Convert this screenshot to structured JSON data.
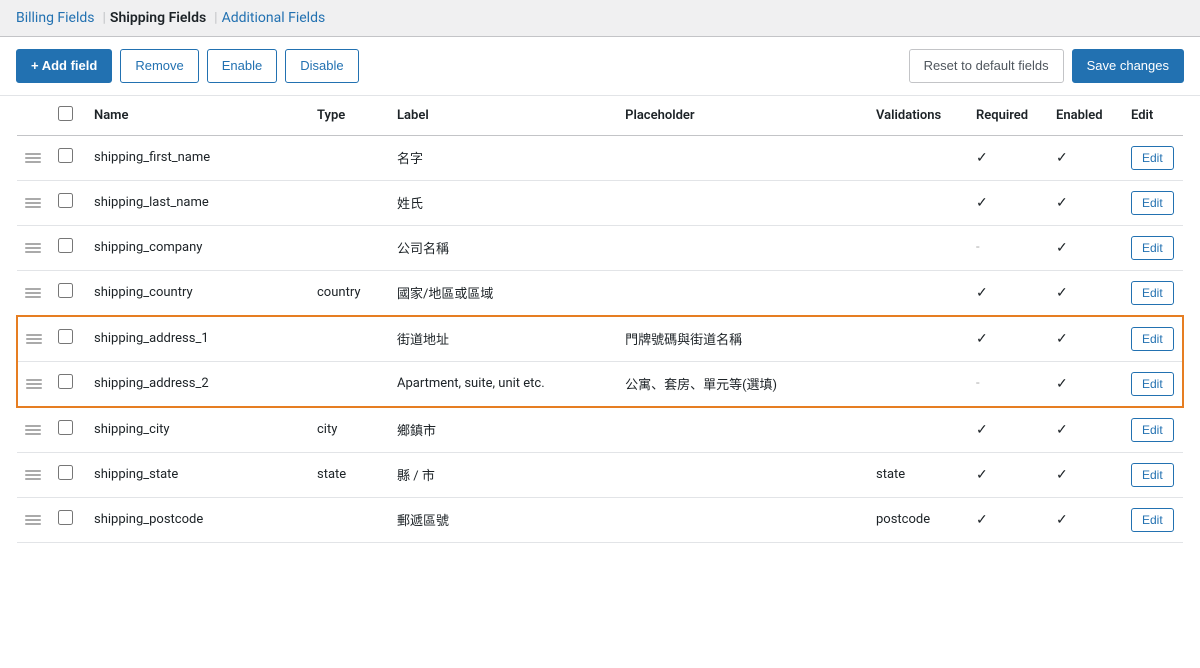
{
  "tabs": [
    {
      "id": "billing",
      "label": "Billing Fields",
      "active": false
    },
    {
      "id": "shipping",
      "label": "Shipping Fields",
      "active": true
    },
    {
      "id": "additional",
      "label": "Additional Fields",
      "active": false
    }
  ],
  "toolbar": {
    "add_field_label": "+ Add field",
    "remove_label": "Remove",
    "enable_label": "Enable",
    "disable_label": "Disable",
    "reset_label": "Reset to default fields",
    "save_label": "Save changes"
  },
  "table": {
    "headers": {
      "name": "Name",
      "type": "Type",
      "label": "Label",
      "placeholder": "Placeholder",
      "validations": "Validations",
      "required": "Required",
      "enabled": "Enabled",
      "edit": "Edit"
    },
    "rows": [
      {
        "name": "shipping_first_name",
        "type": "",
        "label": "名字",
        "placeholder": "",
        "validations": "",
        "required": true,
        "enabled": true,
        "highlighted": false
      },
      {
        "name": "shipping_last_name",
        "type": "",
        "label": "姓氏",
        "placeholder": "",
        "validations": "",
        "required": true,
        "enabled": true,
        "highlighted": false
      },
      {
        "name": "shipping_company",
        "type": "",
        "label": "公司名稱",
        "placeholder": "",
        "validations": "",
        "required": false,
        "enabled": true,
        "highlighted": false
      },
      {
        "name": "shipping_country",
        "type": "country",
        "label": "國家/地區或區域",
        "placeholder": "",
        "validations": "",
        "required": true,
        "enabled": true,
        "highlighted": false
      },
      {
        "name": "shipping_address_1",
        "type": "",
        "label": "街道地址",
        "placeholder": "門牌號碼與街道名稱",
        "validations": "",
        "required": true,
        "enabled": true,
        "highlighted": true,
        "highlight_top": true
      },
      {
        "name": "shipping_address_2",
        "type": "",
        "label": "Apartment, suite, unit etc.",
        "placeholder": "公寓、套房、單元等(選填)",
        "validations": "",
        "required": false,
        "enabled": true,
        "highlighted": true,
        "highlight_bottom": true
      },
      {
        "name": "shipping_city",
        "type": "city",
        "label": "鄉鎮市",
        "placeholder": "",
        "validations": "",
        "required": true,
        "enabled": true,
        "highlighted": false
      },
      {
        "name": "shipping_state",
        "type": "state",
        "label": "縣 / 市",
        "placeholder": "",
        "validations": "state",
        "required": true,
        "enabled": true,
        "highlighted": false
      },
      {
        "name": "shipping_postcode",
        "type": "",
        "label": "郵遞區號",
        "placeholder": "",
        "validations": "postcode",
        "required": true,
        "enabled": true,
        "highlighted": false
      }
    ]
  },
  "colors": {
    "primary": "#2271b1",
    "highlight_border": "#e67e22"
  }
}
